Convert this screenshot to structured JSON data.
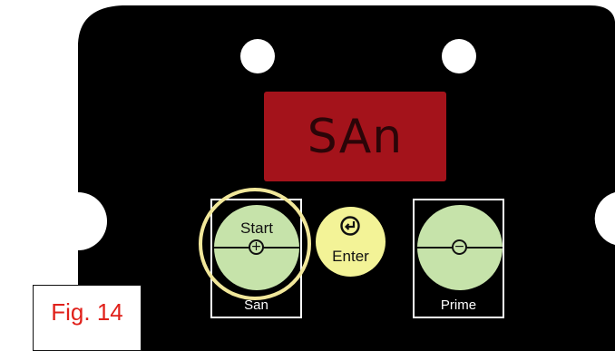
{
  "display": {
    "text": "SAn",
    "background_color": "#a4131b"
  },
  "keys": {
    "start": {
      "label": "Start",
      "sign": "+",
      "under_label": "San",
      "icon": "plus-icon"
    },
    "enter": {
      "label": "Enter",
      "icon": "enter-return-icon"
    },
    "prime": {
      "sign": "−",
      "under_label": "Prime",
      "icon": "minus-icon"
    }
  },
  "highlight": {
    "target": "start",
    "color": "#f1e79a"
  },
  "figure": {
    "label": "Fig. 14",
    "color": "#e0211b"
  },
  "colors": {
    "panel": "#000000",
    "key_green": "#c6e3aa",
    "key_yellow": "#f3f397"
  }
}
